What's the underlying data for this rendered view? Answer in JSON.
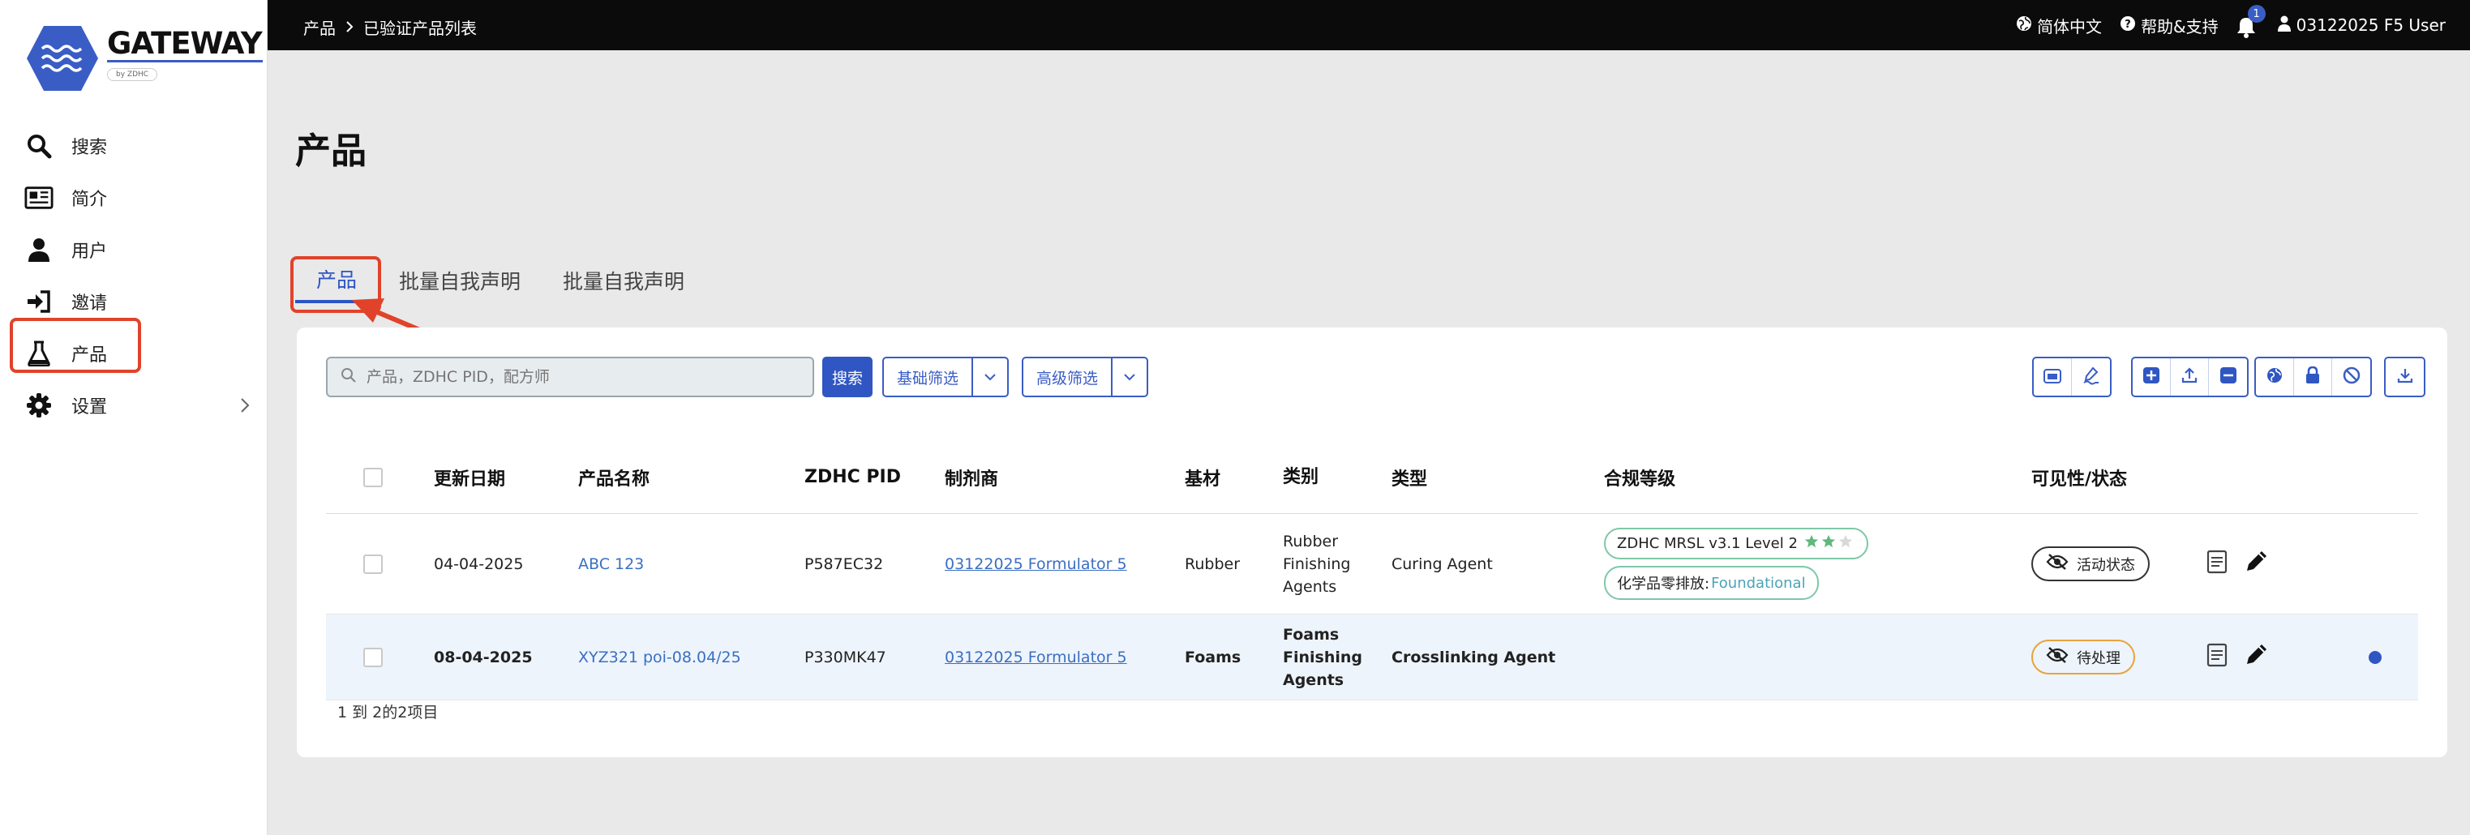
{
  "brand": {
    "name": "GATEWAY",
    "by": "by ZDHC"
  },
  "sidebar": {
    "items": [
      {
        "label": "搜索",
        "icon": "search-icon"
      },
      {
        "label": "简介",
        "icon": "newspaper-icon"
      },
      {
        "label": "用户",
        "icon": "user-icon"
      },
      {
        "label": "邀请",
        "icon": "sign-in-icon"
      },
      {
        "label": "产品",
        "icon": "flask-icon"
      },
      {
        "label": "设置",
        "icon": "gear-icon"
      }
    ]
  },
  "topbar": {
    "breadcrumb": [
      "产品",
      "已验证产品列表"
    ],
    "language": "简体中文",
    "help": "帮助&支持",
    "notifications": "1",
    "user": "03122025 F5 User"
  },
  "page": {
    "title": "产品"
  },
  "tabs": [
    "产品",
    "批量自我声明",
    "批量自我声明"
  ],
  "toolbar": {
    "search_placeholder": "产品，ZDHC PID，配方师",
    "search_button": "搜索",
    "basic_filter": "基础筛选",
    "advanced_filter": "高级筛选"
  },
  "table": {
    "headers": [
      "更新日期",
      "产品名称",
      "ZDHC PID",
      "制剂商",
      "基材",
      "类别",
      "类型",
      "合规等级",
      "可见性/状态"
    ],
    "rows": [
      {
        "date": "04-04-2025",
        "name": "ABC 123",
        "pid": "P587EC32",
        "formulator": "03122025 Formulator 5",
        "substrate": "Rubber",
        "category": [
          "Rubber",
          "Finishing",
          "Agents"
        ],
        "type": "Curing Agent",
        "compliance_mrsl": "ZDHC MRSL v3.1 Level 2",
        "mrsl_stars": 2,
        "compliance_zero_label": "化学品零排放:",
        "compliance_zero_value": "Foundational",
        "status": "活动状态"
      },
      {
        "date": "08-04-2025",
        "name": "XYZ321 poi-08.04/25",
        "pid": "P330MK47",
        "formulator": "03122025 Formulator 5",
        "substrate": "Foams",
        "category": [
          "Foams",
          "Finishing",
          "Agents"
        ],
        "type": "Crosslinking Agent",
        "status": "待处理"
      }
    ],
    "footer": "1 到 2的2项目"
  },
  "colors": {
    "accent": "#2f56c2",
    "highlight": "#e0432a",
    "pending": "#e8a33c",
    "compliance": "#7fc7a8"
  }
}
